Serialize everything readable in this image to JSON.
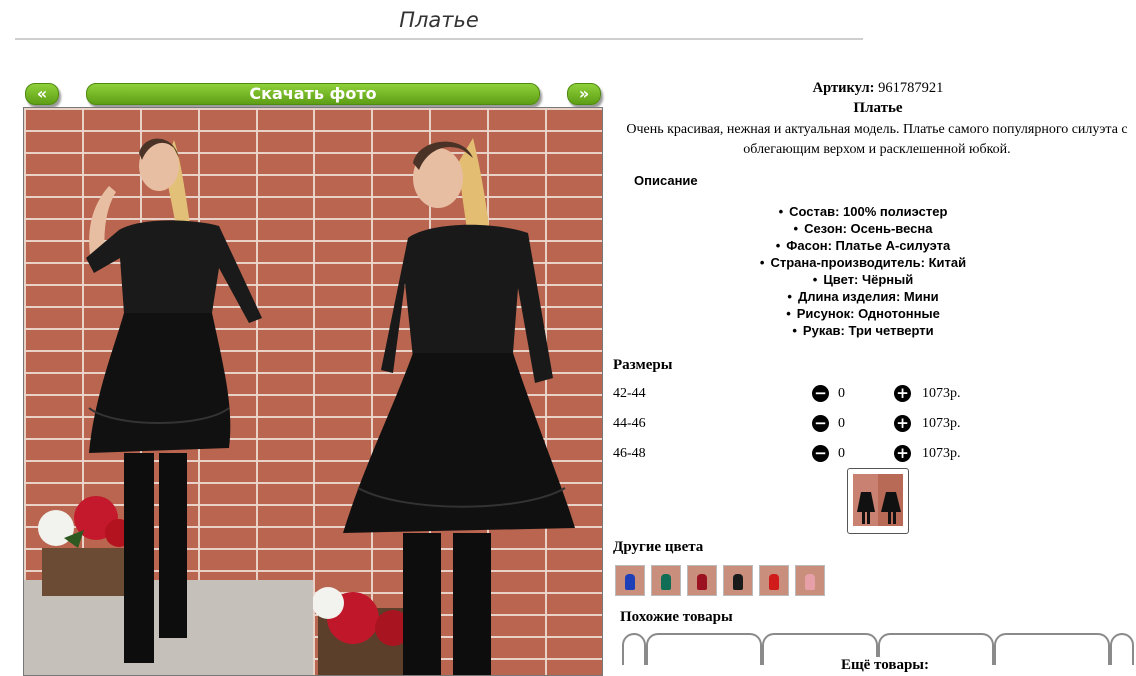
{
  "page": {
    "title": "Платье"
  },
  "gallery": {
    "prev_label": "«",
    "next_label": "»",
    "download_label": "Скачать фото"
  },
  "product": {
    "article_label": "Артикул:",
    "article_value": "961787921",
    "name": "Платье",
    "description": "Очень красивая, нежная и актуальная модель. Платье самого популярного силуэта с облегающим верхом и расклешенной юбкой.",
    "description_heading": "Описание",
    "attributes": [
      "Состав: 100% полиэстер",
      "Сезон: Осень-весна",
      "Фасон: Платье А-силуэта",
      "Страна-производитель: Китай",
      "Цвет: Чёрный",
      "Длина изделия: Мини",
      "Рисунок: Однотонные",
      "Рукав: Три четверти"
    ]
  },
  "sizes": {
    "heading": "Размеры",
    "minus_icon": "minus-circle-icon",
    "plus_icon": "plus-circle-icon",
    "rows": [
      {
        "label": "42-44",
        "qty": "0",
        "price": "1073р."
      },
      {
        "label": "44-46",
        "qty": "0",
        "price": "1073р."
      },
      {
        "label": "46-48",
        "qty": "0",
        "price": "1073р."
      }
    ]
  },
  "other_colors": {
    "heading": "Другие цвета",
    "swatches": [
      "#1f3fb8",
      "#0f6e55",
      "#9b1220",
      "#1a1a1a",
      "#d11a1a",
      "#e7a0a8"
    ]
  },
  "similar": {
    "heading": "Похожие товары",
    "more_label": "Ещё товары:"
  },
  "colors": {
    "button_green": "#6db322",
    "brick": "#b9654f"
  }
}
